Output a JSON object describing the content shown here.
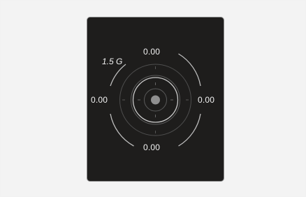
{
  "gforce": {
    "scale_label": "1.5 G",
    "readouts": {
      "top": "0.00",
      "bottom": "0.00",
      "left": "0.00",
      "right": "0.00"
    },
    "colors": {
      "panel_background": "#1e1d1c",
      "ring_outer": "#bdbdbd",
      "ring_inner": "#5a5a5a",
      "indicator_dot": "#8f8f8f",
      "text": "#f2f2f2"
    }
  }
}
